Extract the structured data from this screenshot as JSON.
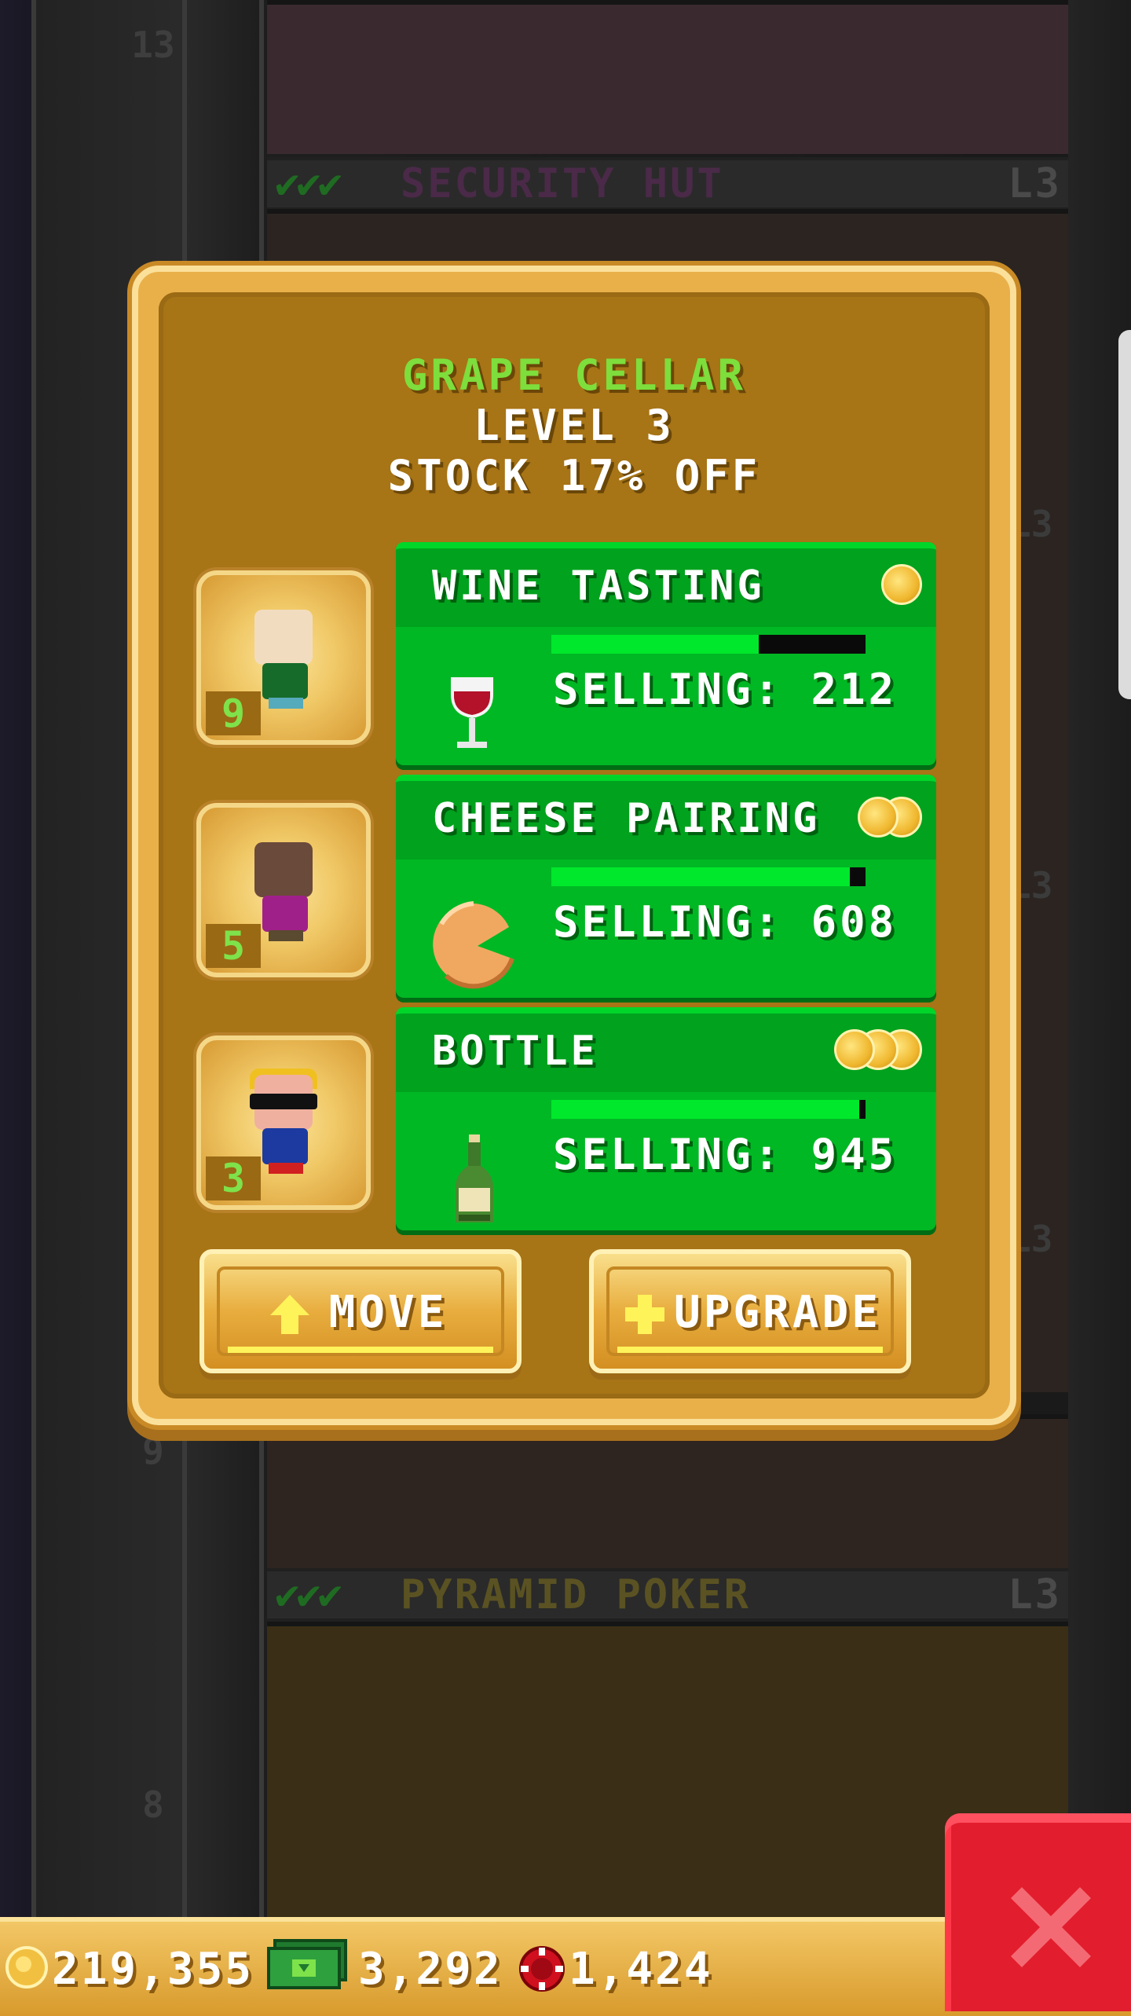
{
  "background": {
    "floors": [
      {
        "number": "13",
        "lvl": "L3"
      },
      {
        "name": "SECURITY HUT",
        "lvl": "L3",
        "checks": "✔✔✔",
        "name_color": "#4a2a48"
      },
      {
        "number": "9",
        "lvl": "L3"
      },
      {
        "name": "PYRAMID POKER",
        "lvl": "L3",
        "checks": "✔✔✔",
        "name_color": "#5a5222"
      },
      {
        "number": "8"
      }
    ],
    "side_levels": [
      "L3",
      "L3",
      "L3"
    ]
  },
  "dialog": {
    "title": "GRAPE CELLAR",
    "level": "LEVEL 3",
    "stock": "STOCK 17% OFF",
    "products": [
      {
        "name": "WINE TASTING",
        "selling": "SELLING: 212",
        "progress": 0.66,
        "coins": 1,
        "worker_badge": "9",
        "icon": "wine-glass-icon"
      },
      {
        "name": "CHEESE PAIRING",
        "selling": "SELLING: 608",
        "progress": 0.95,
        "coins": 2,
        "worker_badge": "5",
        "icon": "cheese-icon"
      },
      {
        "name": "BOTTLE",
        "selling": "SELLING: 945",
        "progress": 0.98,
        "coins": 3,
        "worker_badge": "3",
        "icon": "wine-bottle-icon"
      }
    ],
    "move_label": "MOVE",
    "upgrade_label": "UPGRADE"
  },
  "currency": {
    "coins": "219,355",
    "bux": "3,292",
    "chips": "1,424"
  },
  "colors": {
    "dialog_gold": "#e9b04a",
    "panel_brown": "#a77416",
    "product_green": "#00b824",
    "title_green": "#7dde3c",
    "close_red": "#e21d2d"
  }
}
